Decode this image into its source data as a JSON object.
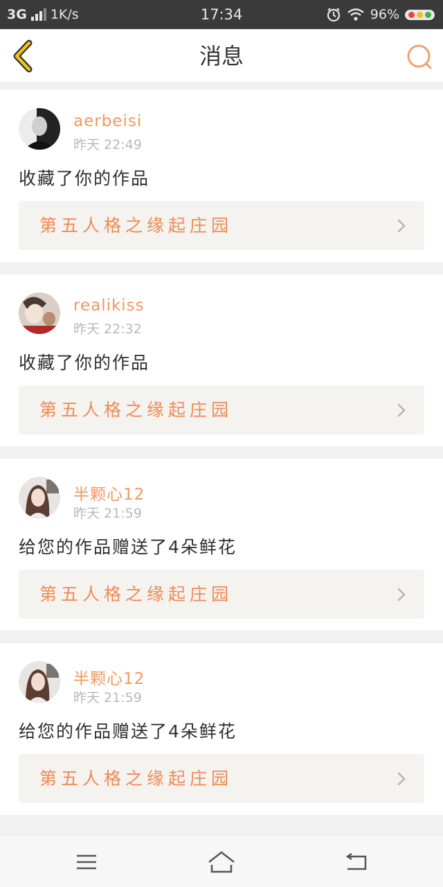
{
  "status_bar": {
    "network": "3G",
    "speed": "1K/s",
    "time": "17:34",
    "battery": "96%"
  },
  "header": {
    "title": "消息",
    "back_icon": "chevron-left-icon",
    "search_icon": "search-icon",
    "accent_color": "#f5a623"
  },
  "messages": [
    {
      "username": "aerbeisi",
      "time": "昨天 22:49",
      "action": "收藏了你的作品",
      "work_title": "第五人格之缘起庄园"
    },
    {
      "username": "realikiss",
      "time": "昨天 22:32",
      "action": "收藏了你的作品",
      "work_title": "第五人格之缘起庄园"
    },
    {
      "username": "半颗心12",
      "time": "昨天 21:59",
      "action": "给您的作品赠送了4朵鲜花",
      "work_title": "第五人格之缘起庄园"
    },
    {
      "username": "半颗心12",
      "time": "昨天 21:59",
      "action": "给您的作品赠送了4朵鲜花",
      "work_title": "第五人格之缘起庄园"
    }
  ],
  "colors": {
    "username": "#ef9964",
    "work_title": "#ef8b55",
    "status_bar": "#3a3a3a"
  },
  "bottom_nav": [
    "menu-icon",
    "home-icon",
    "back-icon"
  ]
}
